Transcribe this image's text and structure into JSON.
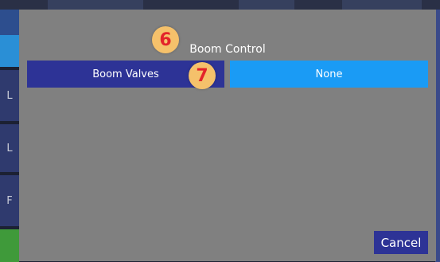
{
  "dialog": {
    "title": "Boom Control",
    "options": [
      {
        "label": "Boom Valves"
      },
      {
        "label": "None"
      }
    ],
    "cancel_label": "Cancel"
  },
  "markers": [
    "6",
    "7"
  ],
  "background_tiles": [
    "L",
    "L",
    "F"
  ],
  "colors": {
    "overlay": "#808080",
    "primary_button": "#2d3396",
    "secondary_button": "#1a9bf5",
    "marker_fill": "#f5c16b",
    "marker_text": "#e3232a"
  }
}
